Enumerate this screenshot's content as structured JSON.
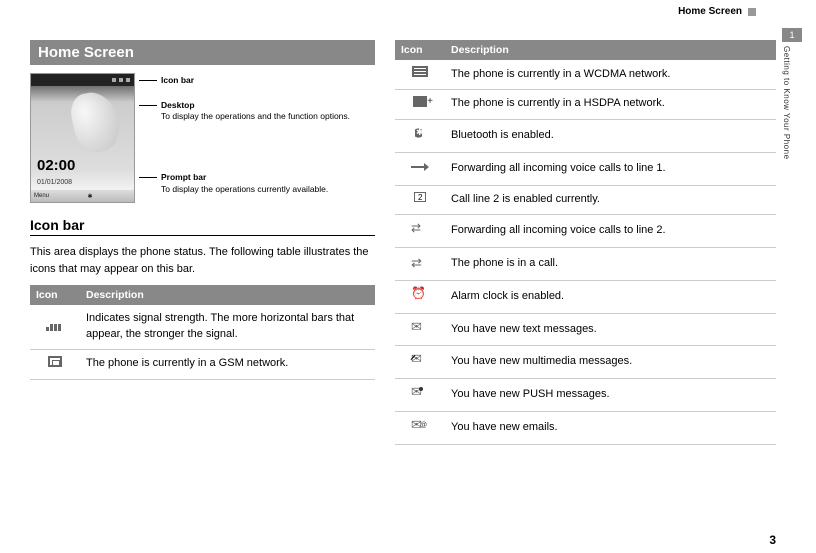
{
  "breadcrumb": "Home Screen",
  "section_title": "Home Screen",
  "callouts": {
    "iconbar": "Icon bar",
    "desktop_label": "Desktop",
    "desktop_desc": "To display the operations and the function options.",
    "prompt_label": "Prompt bar",
    "prompt_desc": "To display the operations currently available."
  },
  "phone": {
    "clock": "02:00",
    "date": "01/01/2008",
    "softleft": "Menu"
  },
  "subhead": "Icon bar",
  "intro": "This area displays the phone status. The following table illustrates the icons that may appear on this bar.",
  "headers": {
    "icon": "Icon",
    "desc": "Description"
  },
  "left_rows": [
    {
      "icon": "signal-icon",
      "desc": "Indicates signal strength. The more horizontal bars that appear, the stronger the signal."
    },
    {
      "icon": "gsm-icon",
      "desc": "The phone is currently in a GSM network."
    }
  ],
  "right_rows": [
    {
      "icon": "wcdma-icon",
      "desc": "The phone is currently in a WCDMA network."
    },
    {
      "icon": "hsdpa-icon",
      "desc": "The phone is currently in a HSDPA network."
    },
    {
      "icon": "bt-icon",
      "desc": "Bluetooth is enabled."
    },
    {
      "icon": "fwd1-icon",
      "desc": "Forwarding all incoming voice calls to line 1."
    },
    {
      "icon": "line2-icon",
      "desc": "Call line 2 is enabled currently."
    },
    {
      "icon": "fwd2-icon",
      "desc": "Forwarding all incoming voice calls to line 2."
    },
    {
      "icon": "call-icon",
      "desc": "The phone is in a call."
    },
    {
      "icon": "alarm-icon",
      "desc": "Alarm clock is enabled."
    },
    {
      "icon": "sms-icon",
      "desc": "You have new text messages."
    },
    {
      "icon": "mms-icon",
      "desc": "You have new multimedia messages."
    },
    {
      "icon": "push-icon",
      "desc": "You have new PUSH messages."
    },
    {
      "icon": "email-icon",
      "desc": "You have new emails."
    }
  ],
  "rail": {
    "chapter": "1",
    "label": "Getting to Know Your Phone"
  },
  "page_number": "3"
}
